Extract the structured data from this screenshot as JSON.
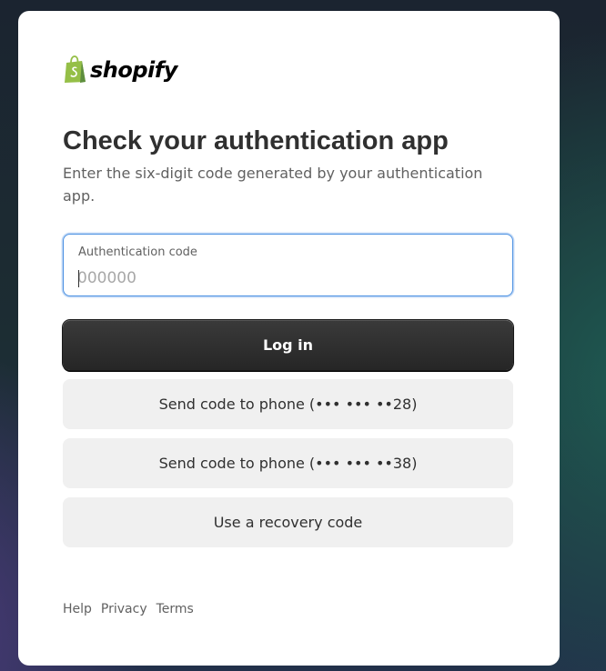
{
  "brand": {
    "name": "shopify",
    "logo_icon": "shopify-bag-icon",
    "logo_color": "#95bf47"
  },
  "heading": {
    "title": "Check your authentication app",
    "subtitle": "Enter the six-digit code generated by your authentication app."
  },
  "auth_field": {
    "label": "Authentication code",
    "placeholder": "000000",
    "value": ""
  },
  "actions": {
    "login_label": "Log in",
    "send_phone_1_label": "Send code to phone (••• ••• ••28)",
    "send_phone_2_label": "Send code to phone (••• ••• ••38)",
    "recovery_label": "Use a recovery code"
  },
  "footer": {
    "links": [
      "Help",
      "Privacy",
      "Terms"
    ]
  },
  "colors": {
    "focus_border": "#4a90e2",
    "primary_button": "#2b2b2b",
    "secondary_button": "#f0f0f0",
    "text": "#303030",
    "muted_text": "#616161"
  }
}
